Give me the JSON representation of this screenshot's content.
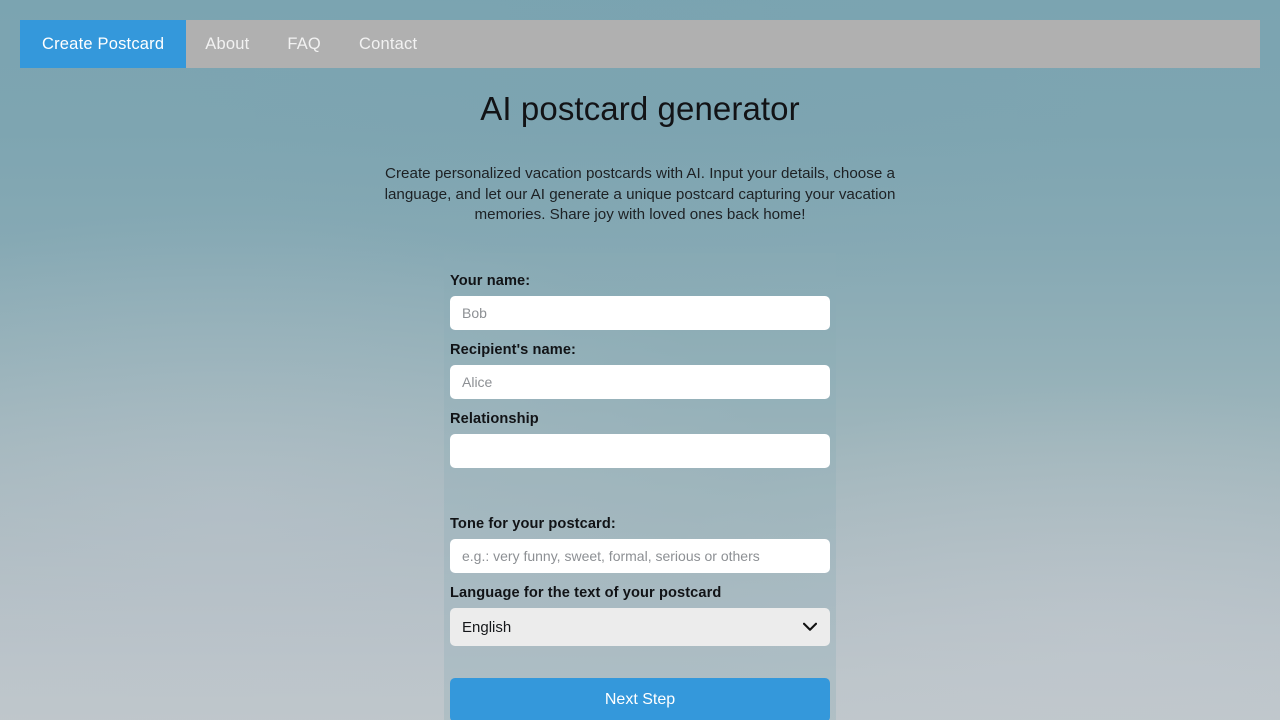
{
  "nav": {
    "items": [
      {
        "label": "Create Postcard",
        "active": true
      },
      {
        "label": "About",
        "active": false
      },
      {
        "label": "FAQ",
        "active": false
      },
      {
        "label": "Contact",
        "active": false
      }
    ]
  },
  "header": {
    "title": "AI postcard generator",
    "description": "Create personalized vacation postcards with AI. Input your details, choose a language, and let our AI generate a unique postcard capturing your vacation memories. Share joy with loved ones back home!"
  },
  "form": {
    "your_name": {
      "label": "Your name:",
      "placeholder": "Bob",
      "value": ""
    },
    "recipient_name": {
      "label": "Recipient's name:",
      "placeholder": "Alice",
      "value": ""
    },
    "relationship": {
      "label": "Relationship",
      "placeholder": "",
      "value": ""
    },
    "tone": {
      "label": "Tone for your postcard:",
      "placeholder": "e.g.: very funny, sweet, formal, serious or others",
      "value": ""
    },
    "language": {
      "label": "Language for the text of your postcard",
      "selected": "English",
      "options": [
        "English"
      ]
    },
    "submit": {
      "label": "Next Step"
    }
  },
  "colors": {
    "accent": "#3498db",
    "nav_inactive_bg": "#b0b0b0",
    "select_bg": "#ececec",
    "input_bg": "#ffffff"
  }
}
